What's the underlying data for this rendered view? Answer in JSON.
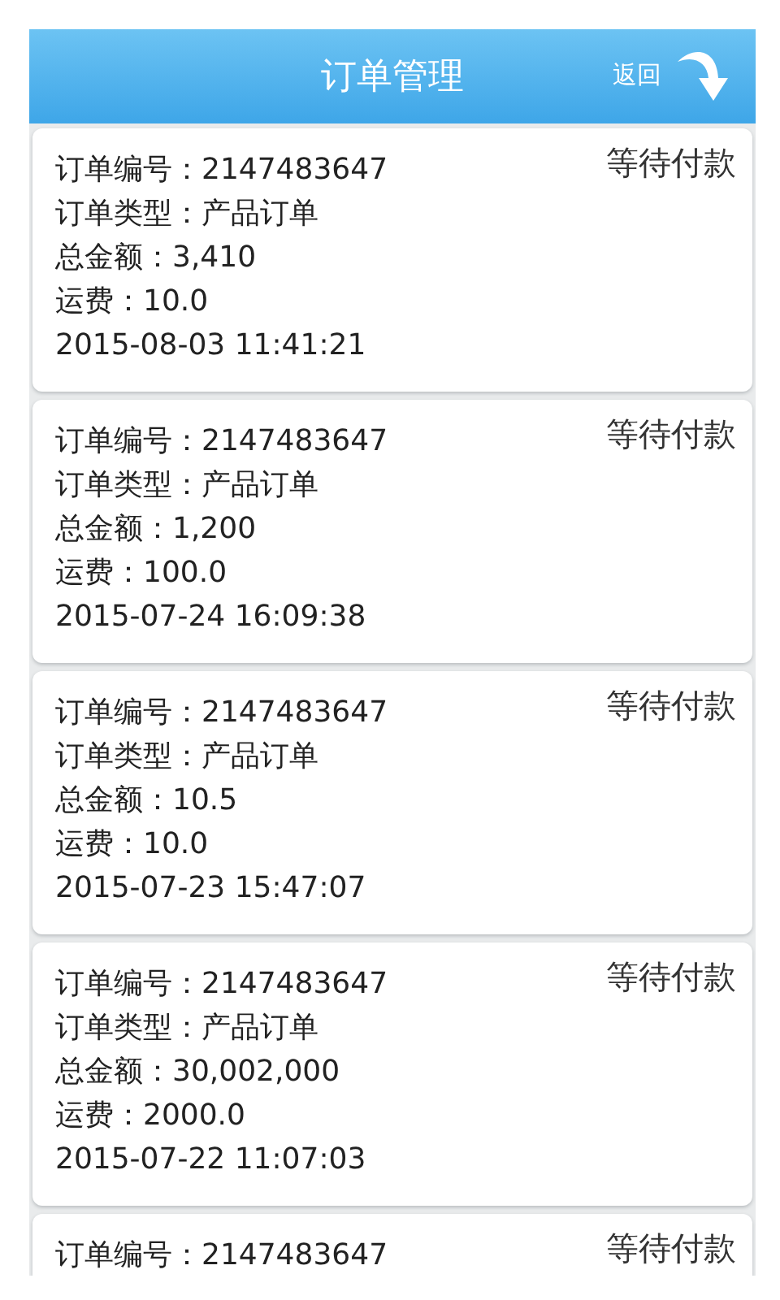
{
  "header": {
    "title": "订单管理",
    "back": "返回"
  },
  "orders": [
    {
      "status": "等待付款",
      "lines": [
        "订单编号：2147483647",
        "订单类型：产品订单",
        "总金额：3,410",
        "运费：10.0",
        "2015-08-03 11:41:21"
      ]
    },
    {
      "status": "等待付款",
      "lines": [
        "订单编号：2147483647",
        "订单类型：产品订单",
        "总金额：1,200",
        "运费：100.0",
        "2015-07-24 16:09:38"
      ]
    },
    {
      "status": "等待付款",
      "lines": [
        "订单编号：2147483647",
        "订单类型：产品订单",
        "总金额：10.5",
        "运费：10.0",
        "2015-07-23 15:47:07"
      ]
    },
    {
      "status": "等待付款",
      "lines": [
        "订单编号：2147483647",
        "订单类型：产品订单",
        "总金额：30,002,000",
        "运费：2000.0",
        "2015-07-22 11:07:03"
      ]
    },
    {
      "status": "等待付款",
      "lines": [
        "订单编号：2147483647"
      ]
    }
  ]
}
